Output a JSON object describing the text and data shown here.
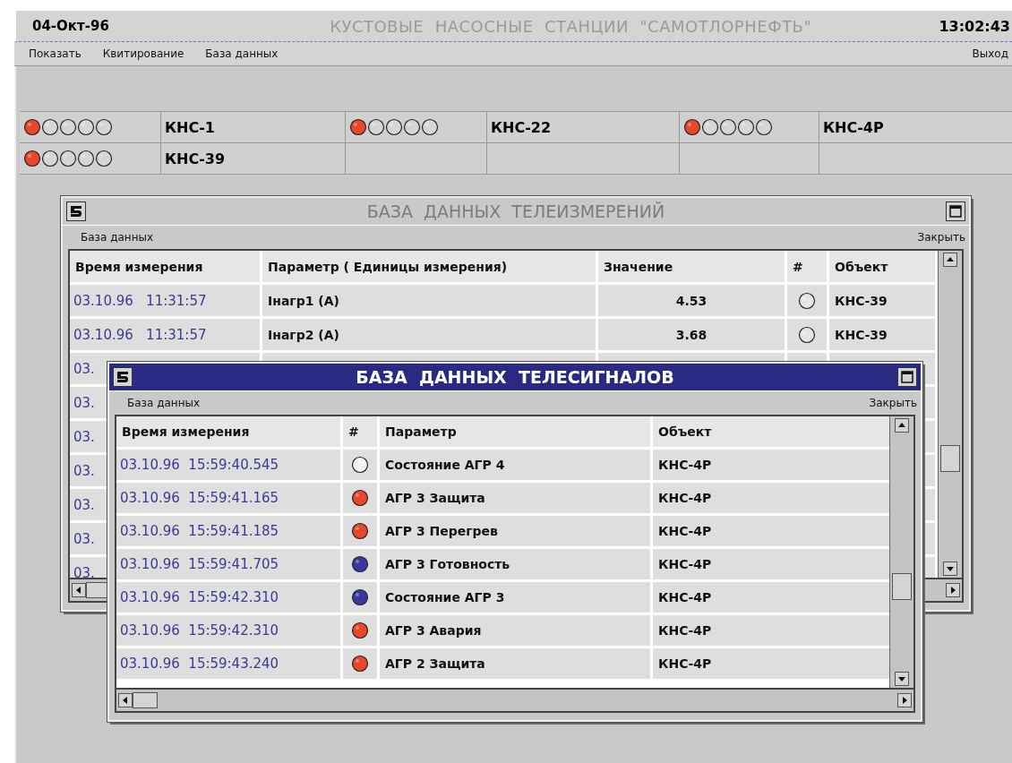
{
  "header": {
    "date": "04-Окт-96",
    "title": "КУСТОВЫЕ  НАСОСНЫЕ  СТАНЦИИ  \"САМОТЛОРНЕФТЬ\"",
    "time": "13:02:43"
  },
  "menu": {
    "items": [
      "Показать",
      "Квитирование",
      "База данных"
    ],
    "exit": "Выход"
  },
  "stations": [
    {
      "name": "КНС-1",
      "lamps": [
        {
          "on": true
        },
        {
          "on": false
        },
        {
          "on": false
        },
        {
          "on": false
        },
        {
          "on": false
        }
      ]
    },
    {
      "name": "КНС-22",
      "lamps": [
        {
          "on": true
        },
        {
          "on": false
        },
        {
          "on": false
        },
        {
          "on": false
        },
        {
          "on": false
        }
      ]
    },
    {
      "name": "КНС-4Р",
      "lamps": [
        {
          "on": true
        },
        {
          "on": false
        },
        {
          "on": false
        },
        {
          "on": false
        },
        {
          "on": false
        }
      ]
    },
    {
      "name": "КНС-39",
      "lamps": [
        {
          "on": true
        },
        {
          "on": false
        },
        {
          "on": false
        },
        {
          "on": false
        },
        {
          "on": false
        }
      ]
    }
  ],
  "telemetry_window": {
    "title": "БАЗА  ДАННЫХ  ТЕЛЕИЗМЕРЕНИЙ",
    "menu": "База данных",
    "close": "Закрыть",
    "columns": [
      "Время измерения",
      "Параметр ( Единицы измерения)",
      "Значение",
      "#",
      "Объект"
    ],
    "rows": [
      {
        "time": "03.10.96   11:31:57",
        "parameter": "Iнагр1 (А)",
        "value": "4.53",
        "object": "КНС-39"
      },
      {
        "time": "03.10.96   11:31:57",
        "parameter": "Iнагр2 (А)",
        "value": "3.68",
        "object": "КНС-39"
      },
      {
        "time": "03."
      },
      {
        "time": "03."
      },
      {
        "time": "03."
      },
      {
        "time": "03."
      },
      {
        "time": "03."
      },
      {
        "time": "03."
      },
      {
        "time": "03."
      }
    ]
  },
  "signals_window": {
    "title": "БАЗА  ДАННЫХ  ТЕЛЕСИГНАЛОВ",
    "menu": "База данных",
    "close": "Закрыть",
    "columns": [
      "Время измерения",
      "#",
      "Параметр",
      "Объект"
    ],
    "rows": [
      {
        "time": "03.10.96  15:59:40.545",
        "color": "#f4f4f4",
        "parameter": "Состояние АГР 4",
        "object": "КНС-4Р"
      },
      {
        "time": "03.10.96  15:59:41.165",
        "color": "#e8472b",
        "parameter": "АГР 3 Защита",
        "object": "КНС-4Р"
      },
      {
        "time": "03.10.96  15:59:41.185",
        "color": "#e8472b",
        "parameter": "АГР 3 Перегрев",
        "object": "КНС-4Р"
      },
      {
        "time": "03.10.96  15:59:41.705",
        "color": "#3a37a0",
        "parameter": "АГР 3 Готовность",
        "object": "КНС-4Р"
      },
      {
        "time": "03.10.96  15:59:42.310",
        "color": "#3a37a0",
        "parameter": "Состояние АГР 3",
        "object": "КНС-4Р"
      },
      {
        "time": "03.10.96  15:59:42.310",
        "color": "#e8472b",
        "parameter": "АГР 3 Авария",
        "object": "КНС-4Р"
      },
      {
        "time": "03.10.96  15:59:43.240",
        "color": "#e8472b",
        "parameter": "АГР 2 Защита",
        "object": "КНС-4Р"
      }
    ]
  }
}
